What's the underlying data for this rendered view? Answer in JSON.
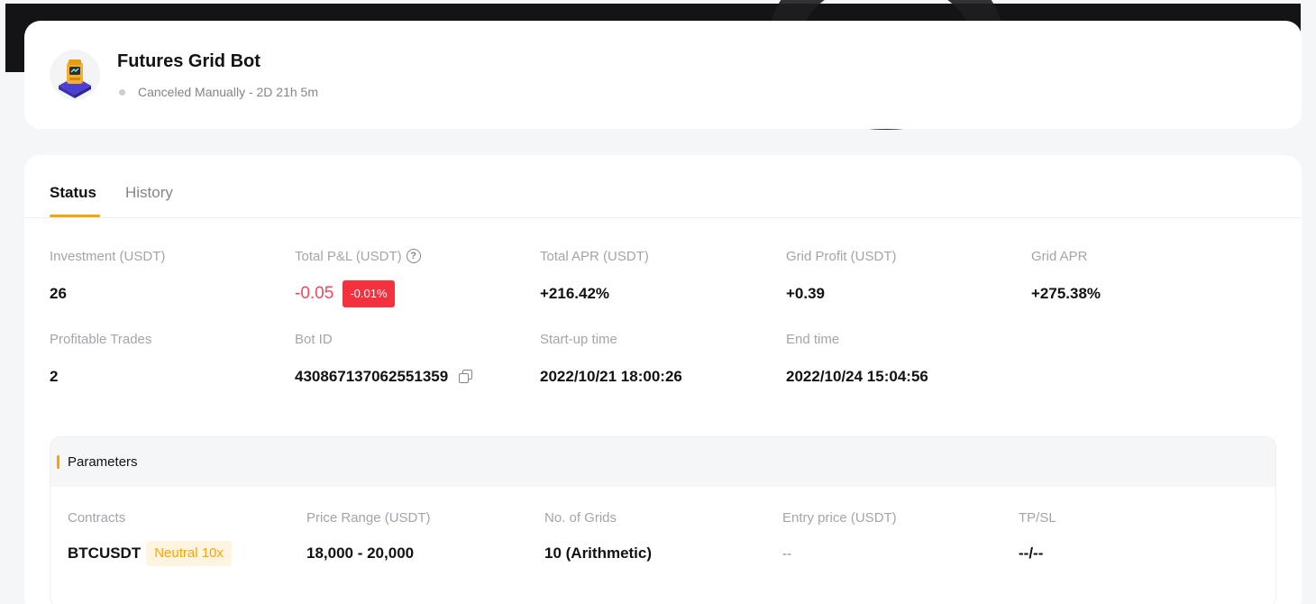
{
  "header": {
    "title": "Futures Grid Bot",
    "status": "Canceled Manually - 2D 21h 5m",
    "avatar_icon": "robot-icon"
  },
  "tabs": [
    {
      "label": "Status",
      "active": true
    },
    {
      "label": "History",
      "active": false
    }
  ],
  "stats": {
    "investment": {
      "label": "Investment (USDT)",
      "value": "26"
    },
    "total_pnl": {
      "label": "Total P&L (USDT)",
      "value": "-0.05",
      "percent": "-0.01%"
    },
    "total_apr": {
      "label": "Total APR (USDT)",
      "value": "+216.42%"
    },
    "grid_profit": {
      "label": "Grid Profit (USDT)",
      "value": "+0.39"
    },
    "grid_apr": {
      "label": "Grid APR",
      "value": "+275.38%"
    },
    "profitable_trades": {
      "label": "Profitable Trades",
      "value": "2"
    },
    "bot_id": {
      "label": "Bot ID",
      "value": "430867137062551359"
    },
    "start_time": {
      "label": "Start-up time",
      "value": "2022/10/21 18:00:26"
    },
    "end_time": {
      "label": "End time",
      "value": "2022/10/24 15:04:56"
    }
  },
  "parameters": {
    "title": "Parameters",
    "contracts": {
      "label": "Contracts",
      "value": "BTCUSDT",
      "mode": "Neutral 10x"
    },
    "price_range": {
      "label": "Price Range (USDT)",
      "value": "18,000 - 20,000"
    },
    "grids": {
      "label": "No. of Grids",
      "value": "10 (Arithmetic)"
    },
    "entry_price": {
      "label": "Entry price (USDT)",
      "value": "--"
    },
    "tpsl": {
      "label": "TP/SL",
      "value": "--/--"
    }
  },
  "colors": {
    "accent": "#f7a600",
    "negative": "#f6465d",
    "negative_badge": "#f5303f"
  }
}
